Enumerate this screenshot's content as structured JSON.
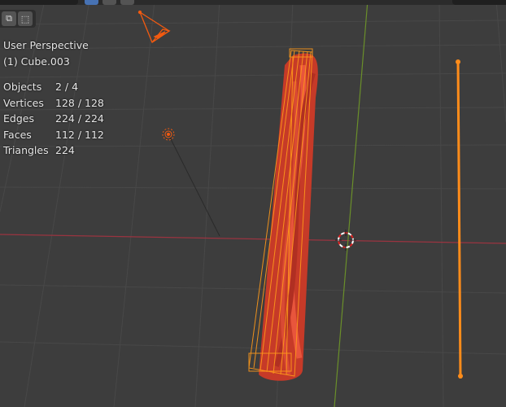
{
  "viewport": {
    "view_name": "User Perspective",
    "active_object": "(1) Cube.003",
    "stats": [
      {
        "label": "Objects",
        "value": "2 / 4"
      },
      {
        "label": "Vertices",
        "value": "128 / 128"
      },
      {
        "label": "Edges",
        "value": "224 / 224"
      },
      {
        "label": "Faces",
        "value": "112 / 112"
      },
      {
        "label": "Triangles",
        "value": "224"
      }
    ]
  },
  "colors": {
    "background": "#3d3d3d",
    "grid": "#4a4a4a",
    "x_axis": "#9a3440",
    "y_axis": "#6a8f2a",
    "selection": "#ff8c1a",
    "mesh": "#d9442c",
    "camera": "#f25a10"
  }
}
